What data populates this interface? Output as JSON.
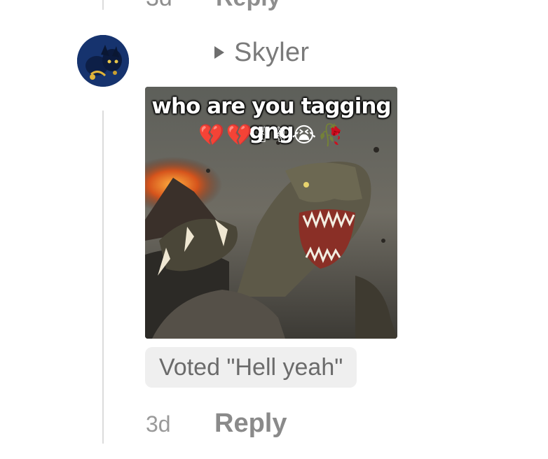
{
  "previous_comment": {
    "time": "3d",
    "reply_label": "Reply"
  },
  "comment": {
    "username": "Skyler",
    "avatar_icon": "fox-icon",
    "image": {
      "caption": "who are you tagging gng",
      "emojis": [
        "💔",
        "💔",
        "✌",
        "✌",
        "😭",
        "🥀"
      ],
      "scene": "roaring-t-rex-volcano"
    },
    "vote": "Voted \"Hell yeah\"",
    "time": "3d",
    "reply_label": "Reply"
  },
  "colors": {
    "text_muted": "#8a8a8a",
    "badge_bg": "#efefef",
    "avatar_bg": "#1a3a78",
    "thread_line": "#dcdcdc"
  }
}
